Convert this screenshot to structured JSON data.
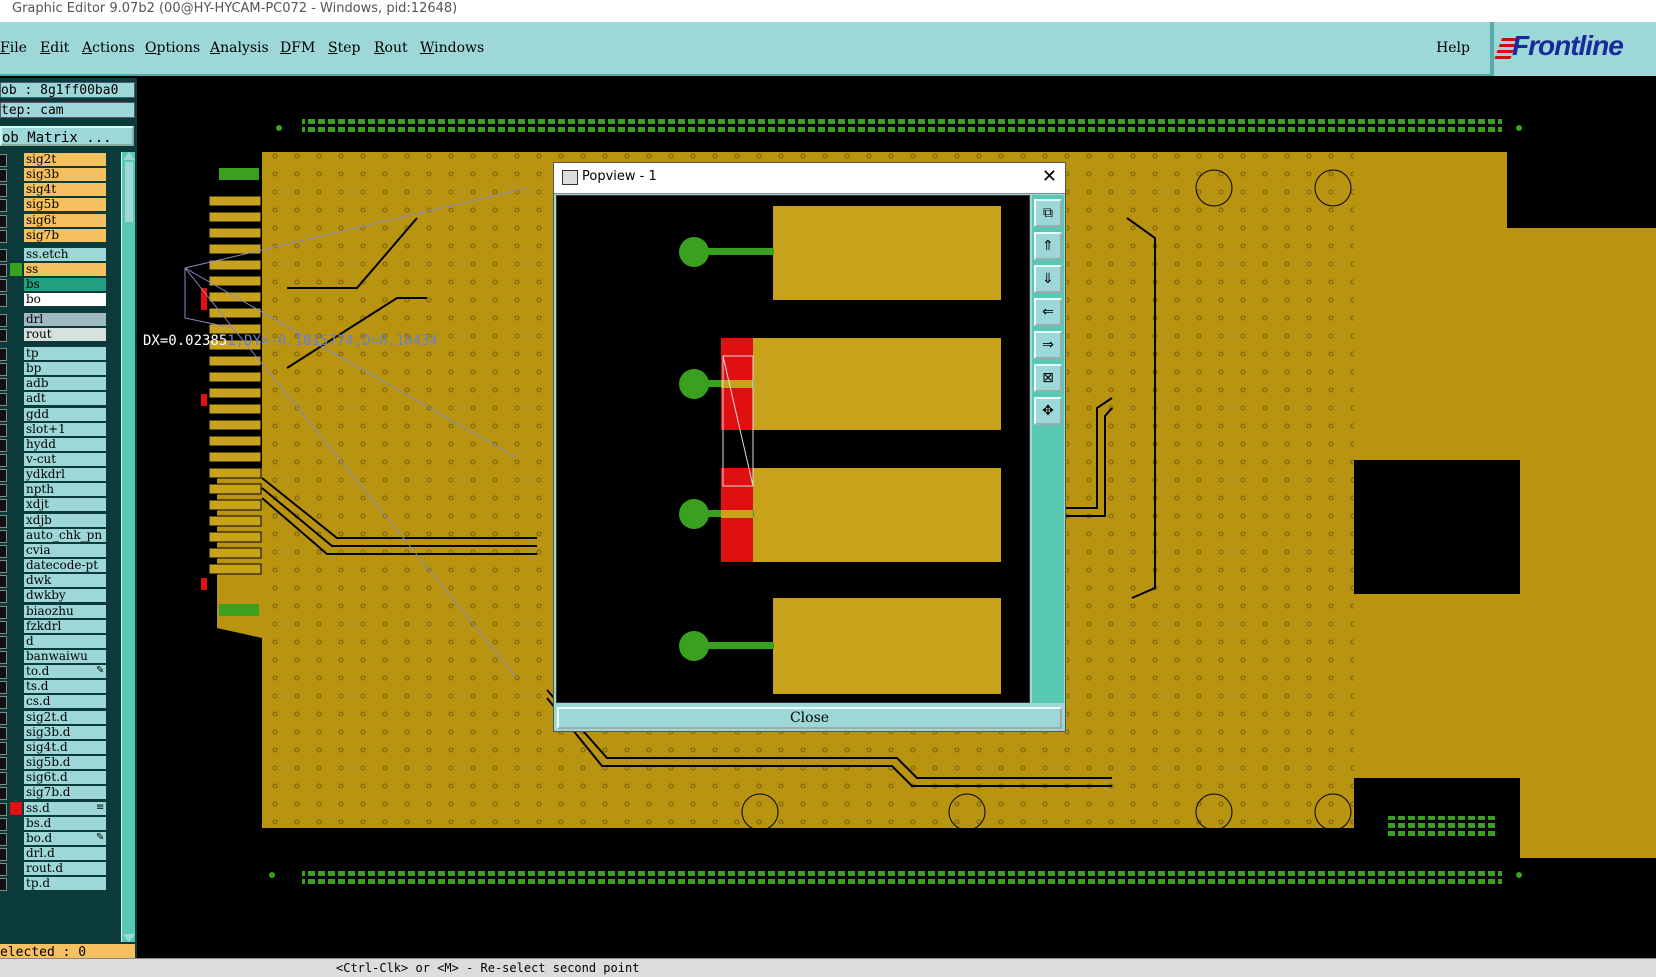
{
  "window": {
    "title": "Graphic Editor 9.07b2 (00@HY-HYCAM-PC072 - Windows, pid:12648)"
  },
  "menu": {
    "items": [
      "File",
      "Edit",
      "Actions",
      "Options",
      "Analysis",
      "DFM",
      "Step",
      "Rout",
      "Windows"
    ],
    "help": "Help"
  },
  "brand": {
    "name": "Frontline"
  },
  "job": {
    "job_label": "ob : 8g1ff00ba0",
    "step_label": "tep: cam",
    "matrix_button": "ob Matrix ..."
  },
  "layers": [
    {
      "name": "sig2t",
      "color": "#f5c060"
    },
    {
      "name": "sig3b",
      "color": "#f5c060"
    },
    {
      "name": "sig4t",
      "color": "#f5c060"
    },
    {
      "name": "sig5b",
      "color": "#f5c060"
    },
    {
      "name": "sig6t",
      "color": "#f5c060"
    },
    {
      "name": "sig7b",
      "color": "#f5c060"
    },
    {
      "name": "ss.etch",
      "color": "#9dd7d7"
    },
    {
      "name": "ss",
      "color": "#f5c060",
      "swatch": "#3aa020"
    },
    {
      "name": "bs",
      "color": "#20a080"
    },
    {
      "name": "bo",
      "color": "#ffffff"
    },
    {
      "name": "drl",
      "color": "#a0b8c0"
    },
    {
      "name": "rout",
      "color": "#d8e0e0"
    },
    {
      "name": "tp",
      "color": "#9dd7d7"
    },
    {
      "name": "bp",
      "color": "#9dd7d7"
    },
    {
      "name": "adb",
      "color": "#9dd7d7"
    },
    {
      "name": "adt",
      "color": "#9dd7d7"
    },
    {
      "name": "gdd",
      "color": "#9dd7d7"
    },
    {
      "name": "slot+1",
      "color": "#9dd7d7"
    },
    {
      "name": "hydd",
      "color": "#9dd7d7"
    },
    {
      "name": "v-cut",
      "color": "#9dd7d7"
    },
    {
      "name": "ydkdrl",
      "color": "#9dd7d7"
    },
    {
      "name": "npth",
      "color": "#9dd7d7"
    },
    {
      "name": "xdjt",
      "color": "#9dd7d7"
    },
    {
      "name": "xdjb",
      "color": "#9dd7d7"
    },
    {
      "name": "auto_chk_pn",
      "color": "#9dd7d7"
    },
    {
      "name": "cvia",
      "color": "#9dd7d7"
    },
    {
      "name": "datecode-pt",
      "color": "#9dd7d7"
    },
    {
      "name": "dwk",
      "color": "#9dd7d7"
    },
    {
      "name": "dwkby",
      "color": "#9dd7d7"
    },
    {
      "name": "biaozhu",
      "color": "#9dd7d7"
    },
    {
      "name": "fzkdrl",
      "color": "#9dd7d7"
    },
    {
      "name": "d",
      "color": "#9dd7d7"
    },
    {
      "name": "banwaiwu",
      "color": "#9dd7d7"
    },
    {
      "name": "to.d",
      "color": "#9dd7d7",
      "flag": "✎"
    },
    {
      "name": "ts.d",
      "color": "#9dd7d7"
    },
    {
      "name": "cs.d",
      "color": "#9dd7d7"
    },
    {
      "name": "sig2t.d",
      "color": "#9dd7d7"
    },
    {
      "name": "sig3b.d",
      "color": "#9dd7d7"
    },
    {
      "name": "sig4t.d",
      "color": "#9dd7d7"
    },
    {
      "name": "sig5b.d",
      "color": "#9dd7d7"
    },
    {
      "name": "sig6t.d",
      "color": "#9dd7d7"
    },
    {
      "name": "sig7b.d",
      "color": "#9dd7d7"
    },
    {
      "name": "ss.d",
      "color": "#9dd7d7",
      "swatch": "#e01010",
      "flag": "≡"
    },
    {
      "name": "bs.d",
      "color": "#9dd7d7"
    },
    {
      "name": "bo.d",
      "color": "#9dd7d7",
      "flag": "✎"
    },
    {
      "name": "drl.d",
      "color": "#9dd7d7"
    },
    {
      "name": "rout.d",
      "color": "#9dd7d7"
    },
    {
      "name": "tp.d",
      "color": "#9dd7d7"
    }
  ],
  "selected": "elected : 0",
  "measurement": {
    "prefix": "DX=0.02385",
    "rest": "1,DY=-0.1015774,D=0.10434"
  },
  "status": {
    "prompt": "<Ctrl-Clk> or <M> - Re-select second point"
  },
  "popview": {
    "title": "Popview - 1",
    "close_label": "Close",
    "tools": [
      "zoom-fit-icon",
      "arrow-up-icon",
      "arrow-down-icon",
      "arrow-left-icon",
      "arrow-right-icon",
      "zoom-home-icon",
      "pan-icon"
    ]
  },
  "colors": {
    "board": "#b89410",
    "pad": "#c8a21a",
    "panel": "#9dd7d7",
    "accent": "#58c8b0",
    "highlight": "#e01010",
    "green": "#3aa020"
  }
}
